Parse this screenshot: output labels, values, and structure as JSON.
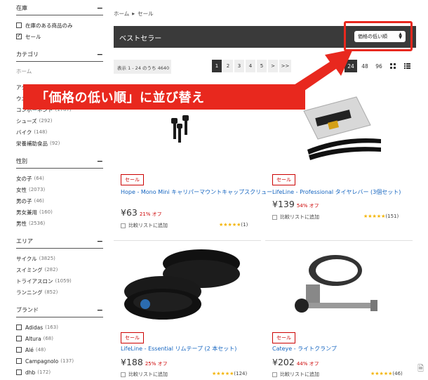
{
  "sidebar": {
    "stock": {
      "heading": "在庫",
      "items": [
        {
          "label": "在庫のある商品のみ",
          "checked": false
        },
        {
          "label": "セール",
          "checked": true
        }
      ]
    },
    "category": {
      "heading": "カテゴリ",
      "home": "ホーム",
      "items": [
        {
          "label": "アクセサリー",
          "count": ""
        },
        {
          "label": "ウエア",
          "count": "(1"
        },
        {
          "label": "コンポーネント",
          "count": "(1787)"
        },
        {
          "label": "シューズ",
          "count": "(292)"
        },
        {
          "label": "バイク",
          "count": "(148)"
        },
        {
          "label": "栄養補助食品",
          "count": "(92)"
        }
      ]
    },
    "gender": {
      "heading": "性別",
      "items": [
        {
          "label": "女の子",
          "count": "(64)"
        },
        {
          "label": "女性",
          "count": "(2073)"
        },
        {
          "label": "男の子",
          "count": "(46)"
        },
        {
          "label": "男女兼用",
          "count": "(160)"
        },
        {
          "label": "男性",
          "count": "(2536)"
        }
      ]
    },
    "area": {
      "heading": "エリア",
      "items": [
        {
          "label": "サイクル",
          "count": "(3825)"
        },
        {
          "label": "スイミング",
          "count": "(282)"
        },
        {
          "label": "トライアスロン",
          "count": "(1059)"
        },
        {
          "label": "ランニング",
          "count": "(852)"
        }
      ]
    },
    "brand": {
      "heading": "ブランド",
      "items": [
        {
          "label": "Adidas",
          "count": "(163)"
        },
        {
          "label": "Altura",
          "count": "(68)"
        },
        {
          "label": "Alé",
          "count": "(48)"
        },
        {
          "label": "Campagnolo",
          "count": "(137)"
        },
        {
          "label": "dhb",
          "count": "(172)"
        }
      ]
    },
    "minus": "−"
  },
  "breadcrumb": {
    "home": "ホーム",
    "current": "セール"
  },
  "header": {
    "title": "ベストセラー",
    "sort_value": "価格の低い順"
  },
  "results": {
    "count_text": "表示 1 - 24 のうち 4640"
  },
  "pager": {
    "pages": [
      "1",
      "2",
      "3",
      "4",
      "5",
      ">",
      ">>"
    ],
    "active": "1"
  },
  "per_page": {
    "options": [
      "24",
      "48",
      "96"
    ],
    "active": "24"
  },
  "callout": {
    "text": "「価格の低い順」に並び替え"
  },
  "colors": {
    "accent_red": "#e8281e",
    "link_blue": "#1565c0",
    "sale_red": "#cc0000",
    "star_gold": "#f4b400",
    "bar_dark": "#3a3a3a"
  },
  "products": [
    {
      "sale": "セール",
      "name": "Hope - Mono Mini キャリパーマウントキャップスクリュー",
      "price": "¥63",
      "discount": "21% オフ",
      "compare": "比較リストに追加",
      "stars": "★★★★★",
      "rating_count": "(1)",
      "image": "black-screws"
    },
    {
      "sale": "セール",
      "name": "LifeLine - Professional タイヤレバー (3個セット)",
      "price": "¥139",
      "discount": "54% オフ",
      "compare": "比較リストに追加",
      "stars": "★★★★★",
      "rating_count": "(151)",
      "image": "tyre-levers"
    },
    {
      "sale": "セール",
      "name": "LifeLine - Essential リムテープ (2 本セット)",
      "price": "¥188",
      "discount": "25% オフ",
      "compare": "比較リストに追加",
      "stars": "★★★★★",
      "rating_count": "(124)",
      "image": "rim-tape"
    },
    {
      "sale": "セール",
      "name": "Cateye - ライトクランプ",
      "price": "¥202",
      "discount": "44% オフ",
      "compare": "比較リストに追加",
      "stars": "★★★★★",
      "rating_count": "(46)",
      "image": "light-clamp"
    }
  ]
}
